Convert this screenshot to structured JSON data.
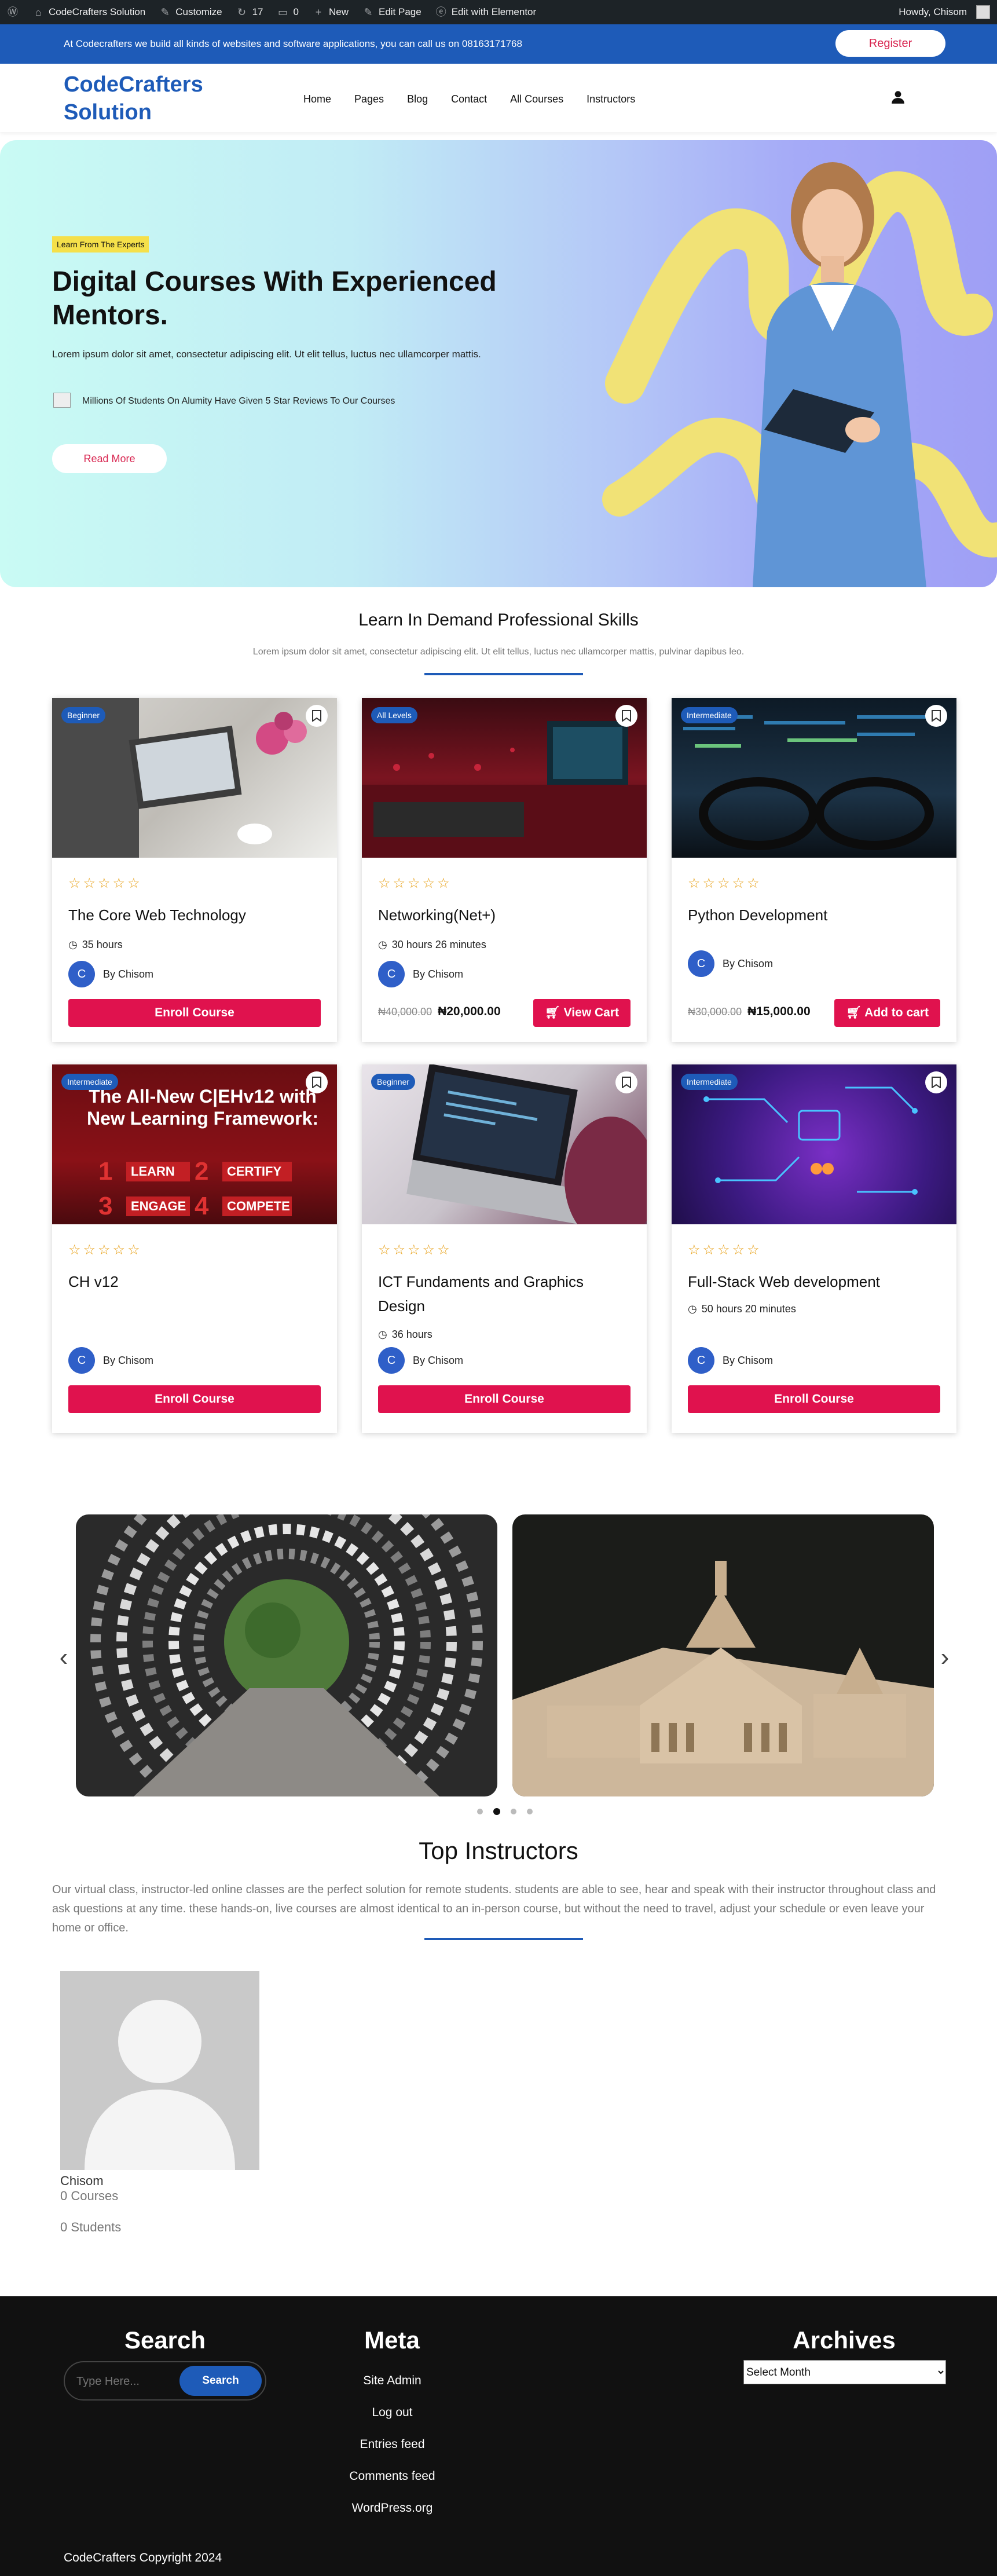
{
  "admin_bar": {
    "site_name": "CodeCrafters Solution",
    "customize": "Customize",
    "updates_count": "17",
    "comments_count": "0",
    "new_label": "New",
    "edit_page": "Edit Page",
    "edit_elementor": "Edit with Elementor",
    "howdy": "Howdy, Chisom"
  },
  "topbar": {
    "message": "At Codecrafters we build all kinds of websites and software applications, you can call us on 08163171768",
    "register_label": "Register"
  },
  "header": {
    "logo_line1": "CodeCrafters",
    "logo_line2": "Solution",
    "nav": [
      "Home",
      "Pages",
      "Blog",
      "Contact",
      "All Courses",
      "Instructors"
    ]
  },
  "hero": {
    "badge": "Learn From The Experts",
    "title": "Digital Courses With Experienced Mentors.",
    "subtitle": "Lorem ipsum dolor sit amet, consectetur adipiscing elit. Ut elit tellus, luctus nec ullamcorper mattis.",
    "reviews": "Millions Of Students On Alumity Have Given 5 Star Reviews To Our Courses",
    "button": "Read More"
  },
  "courses_section": {
    "title": "Learn In Demand Professional Skills",
    "subtitle": "Lorem ipsum dolor sit amet, consectetur adipiscing elit. Ut elit tellus, luctus nec ullamcorper mattis, pulvinar dapibus leo.",
    "stars": "☆☆☆☆☆",
    "author_initial": "C",
    "author": "By Chisom",
    "courses": [
      {
        "level": "Beginner",
        "title": "The Core Web Technology",
        "duration": "35 hours",
        "button": "Enroll Course"
      },
      {
        "level": "All Levels",
        "title": "Networking(Net+)",
        "duration": "30 hours 26 minutes",
        "old_price": "₦40,000.00",
        "price": "₦20,000.00",
        "button": "View Cart"
      },
      {
        "level": "Intermediate",
        "title": "Python Development",
        "old_price": "₦30,000.00",
        "price": "₦15,000.00",
        "button": "Add to cart"
      },
      {
        "level": "Intermediate",
        "title": "CH v12",
        "thumb_text": "The All-New C|EHv12 with New Learning Framework:",
        "thumb_items": [
          "LEARN",
          "CERTIFY",
          "ENGAGE",
          "COMPETE"
        ],
        "thumb_numbers": [
          "1",
          "2",
          "3",
          "4"
        ],
        "button": "Enroll Course"
      },
      {
        "level": "Beginner",
        "title": "ICT Fundaments and Graphics Design",
        "duration": "36 hours",
        "button": "Enroll Course"
      },
      {
        "level": "Intermediate",
        "title": "Full-Stack Web development",
        "duration": "50 hours 20 minutes",
        "button": "Enroll Course"
      }
    ]
  },
  "slider": {
    "left_arrow": "‹",
    "right_arrow": "›",
    "active_dot": 1,
    "dot_count": 4
  },
  "instructors": {
    "title": "Top Instructors",
    "description": "Our virtual class, instructor-led online classes are the perfect solution for remote students. students are able to see, hear and speak with their instructor throughout class and ask questions at any time. these hands-on, live courses are almost identical to an in-person course, but without the need to travel, adjust your schedule or even leave your home or office.",
    "list": [
      {
        "name": "Chisom",
        "courses": "0 Courses",
        "students": "0 Students"
      }
    ]
  },
  "footer": {
    "search_title": "Search",
    "search_placeholder": "Type Here...",
    "search_button": "Search",
    "meta_title": "Meta",
    "meta_links": [
      "Site Admin",
      "Log out",
      "Entries feed",
      "Comments feed",
      "WordPress.org"
    ],
    "archives_title": "Archives",
    "archives_select": "Select Month",
    "copyright": "CodeCrafters Copyright 2024"
  },
  "colors": {
    "brand_blue": "#1e5bb8",
    "accent_red": "#e0124e",
    "badge_yellow": "#f5e04a",
    "footer_bg": "#111111",
    "star": "#e8a21a"
  }
}
